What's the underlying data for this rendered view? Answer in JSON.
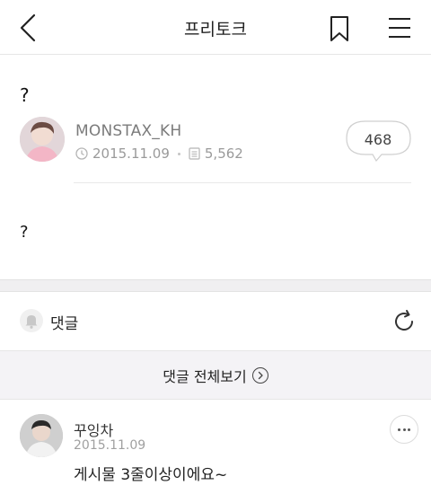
{
  "header": {
    "title": "프리토크",
    "back_icon": "chevron-left-icon",
    "bookmark_icon": "bookmark-icon",
    "menu_icon": "hamburger-menu-icon"
  },
  "post": {
    "title": "?",
    "author": "MONSTAX_KH",
    "date": "2015.11.09",
    "views": "5,562",
    "comment_count": "468",
    "body": "?"
  },
  "comments": {
    "label": "댓글",
    "view_all_label": "댓글 전체보기",
    "items": [
      {
        "author": "꾸잉차",
        "date": "2015.11.09",
        "text": "게시물 3줄이상이에요~"
      }
    ]
  },
  "colors": {
    "background": "#ffffff",
    "section_gap": "#f0eff1",
    "view_all_bg": "#f4f3f6",
    "muted_text": "#9a9a9a"
  }
}
